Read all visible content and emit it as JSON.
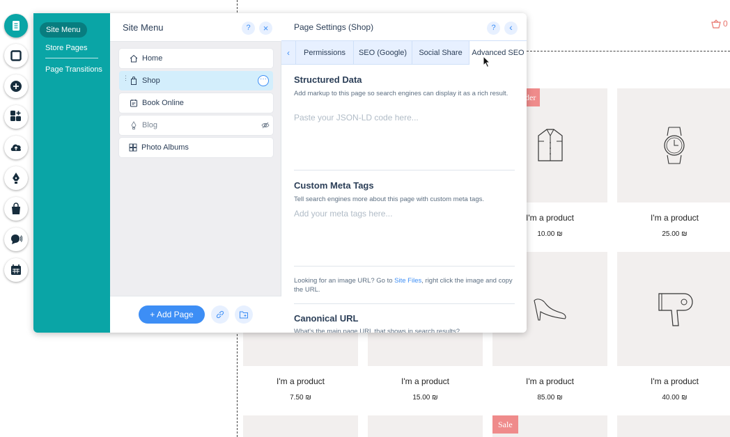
{
  "cart": {
    "count": "0"
  },
  "products": [
    {
      "name": "I'm a product",
      "price": "10.00 ₪"
    },
    {
      "name": "I'm a product",
      "price": "25.00 ₪"
    },
    {
      "name": "I'm a product",
      "price": "7.50 ₪"
    },
    {
      "name": "I'm a product",
      "price": "15.00 ₪"
    },
    {
      "name": "I'm a product",
      "price": "85.00 ₪"
    },
    {
      "name": "I'm a product",
      "price": "40.00 ₪"
    }
  ],
  "sale_badges": {
    "top_partial": "der",
    "bottom": "Sale"
  },
  "toolbar": {
    "icons": [
      "pages-icon",
      "background-icon",
      "add-icon",
      "apps-icon",
      "upload-icon",
      "blog-pen-icon",
      "store-bag-icon",
      "chat-icon",
      "bookings-calendar-icon"
    ]
  },
  "nav": {
    "active": "Site Menu",
    "items": [
      "Store Pages",
      "Page Transitions"
    ]
  },
  "site_menu": {
    "title": "Site Menu",
    "help": "?",
    "close": "×",
    "pages": [
      {
        "label": "Home",
        "icon": "home-icon"
      },
      {
        "label": "Shop",
        "icon": "shop-bag-icon",
        "selected": true
      },
      {
        "label": "Book Online",
        "icon": "bookings-icon"
      },
      {
        "label": "Blog",
        "icon": "blog-icon",
        "hidden": true
      },
      {
        "label": "Photo Albums",
        "icon": "albums-icon"
      }
    ],
    "more": "···",
    "add_page": "+ Add Page"
  },
  "page_settings": {
    "title": "Page Settings (Shop)",
    "help": "?",
    "back": "‹",
    "tabs_back": "‹",
    "tabs": [
      "Permissions",
      "SEO (Google)",
      "Social Share",
      "Advanced SEO"
    ],
    "active_tab": "Advanced SEO",
    "structured": {
      "title": "Structured Data",
      "desc": "Add markup to this page so search engines can display it as a rich result.",
      "placeholder": "Paste your JSON-LD code here..."
    },
    "meta": {
      "title": "Custom Meta Tags",
      "desc": "Tell search engines more about this page with custom meta tags.",
      "placeholder": "Add your meta tags here..."
    },
    "tip": {
      "before": "Looking for an image URL? Go to ",
      "link": "Site Files",
      "after": ", right click the image and copy the URL."
    },
    "canonical": {
      "title": "Canonical URL",
      "desc": "What's the main page URL that shows in search results?"
    }
  }
}
